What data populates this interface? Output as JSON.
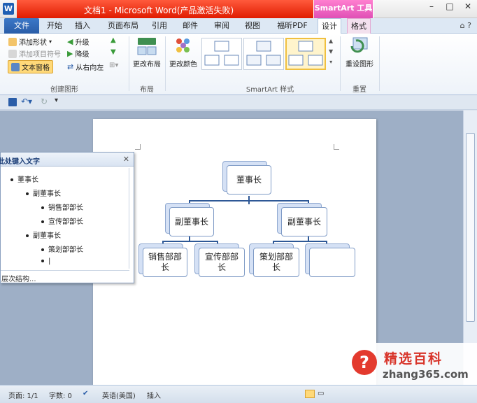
{
  "window": {
    "title": "文档1 - Microsoft Word(产品激活失败)",
    "contextual_tab_group": "SmartArt 工具",
    "controls": [
      "–",
      "□",
      "✕"
    ]
  },
  "tabs": [
    {
      "label": "文件"
    },
    {
      "label": "开始"
    },
    {
      "label": "插入"
    },
    {
      "label": "页面布局"
    },
    {
      "label": "引用"
    },
    {
      "label": "邮件"
    },
    {
      "label": "审阅"
    },
    {
      "label": "视图"
    },
    {
      "label": "福昕PDF"
    },
    {
      "label": "设计"
    },
    {
      "label": "格式"
    }
  ],
  "ribbon": {
    "create_graphic": {
      "add_shape": "添加形状",
      "add_bullet": "添加项目符号",
      "text_pane": "文本窗格",
      "promote": "升级",
      "demote": "降级",
      "right_to_left": "从右向左",
      "label": "创建图形"
    },
    "layouts": {
      "change_layout": "更改布局",
      "label": "布局"
    },
    "styles": {
      "change_colors": "更改颜色",
      "label": "SmartArt 样式"
    },
    "reset": {
      "reset_graphic": "重设图形",
      "label": "重置"
    }
  },
  "smartart": {
    "root": "董事长",
    "level2": [
      "副董事长",
      "副董事长"
    ],
    "level3": [
      "销售部部长",
      "宣传部部长",
      "策划部部长",
      ""
    ]
  },
  "text_pane": {
    "title": "在此处键入文字",
    "close": "✕",
    "items": [
      {
        "text": "董事长",
        "level": 1
      },
      {
        "text": "副董事长",
        "level": 2
      },
      {
        "text": "销售部部长",
        "level": 3
      },
      {
        "text": "宣传部部长",
        "level": 3
      },
      {
        "text": "副董事长",
        "level": 2
      },
      {
        "text": "策划部部长",
        "level": 3
      },
      {
        "text": "|",
        "level": 3
      }
    ],
    "footer": "层次结构..."
  },
  "status": {
    "page": "页面: 1/1",
    "words": "字数: 0",
    "language": "英语(美国)",
    "mode": "插入"
  },
  "watermark": {
    "title": "精选百科",
    "url": "zhang365.com",
    "logo": "?"
  },
  "colors": {
    "title_red": "#e01b00",
    "smartart_pink": "#e050b6",
    "file_tab_blue": "#2a5da8",
    "box_border": "#7f9bc6",
    "connector": "#2e5896"
  }
}
